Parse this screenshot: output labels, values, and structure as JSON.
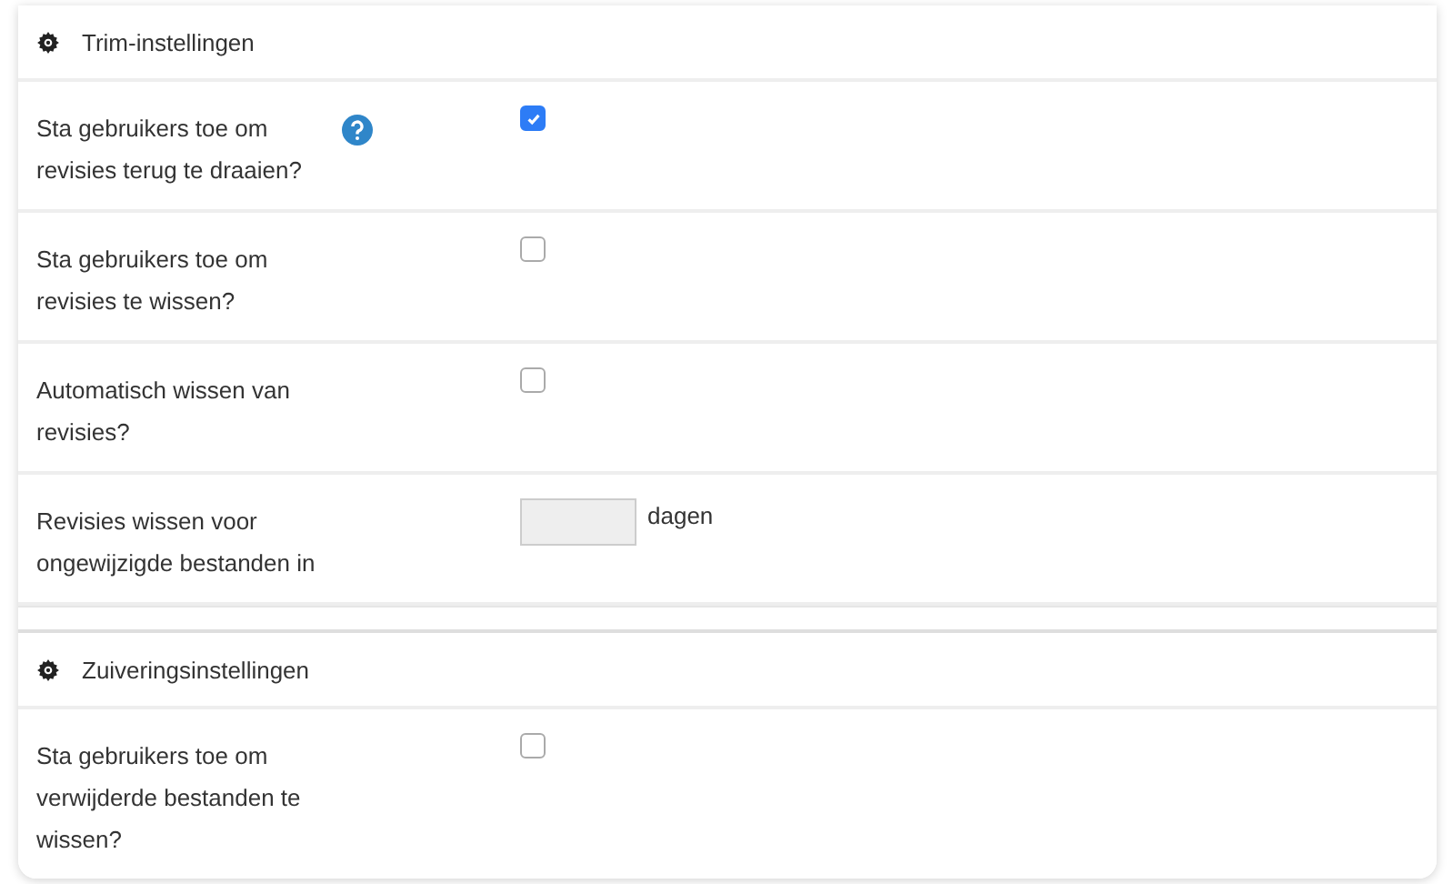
{
  "sections": [
    {
      "title": "Trim-instellingen",
      "rows": [
        {
          "kind": "checkbox",
          "label": "Sta gebruikers toe om revisies terug te draaien?",
          "help": true,
          "checked": true
        },
        {
          "kind": "checkbox",
          "label": "Sta gebruikers toe om revisies te wissen?",
          "help": false,
          "checked": false
        },
        {
          "kind": "checkbox",
          "label": "Automatisch wissen van revisies?",
          "help": false,
          "checked": false
        },
        {
          "kind": "number",
          "label": "Revisies wissen voor ongewijzigde bestanden in",
          "help": false,
          "unit": "dagen"
        }
      ]
    },
    {
      "title": "Zuiveringsinstellingen",
      "rows": [
        {
          "kind": "checkbox",
          "label": "Sta gebruikers toe om verwijderde bestanden te wissen?",
          "help": false,
          "checked": false
        }
      ]
    }
  ]
}
